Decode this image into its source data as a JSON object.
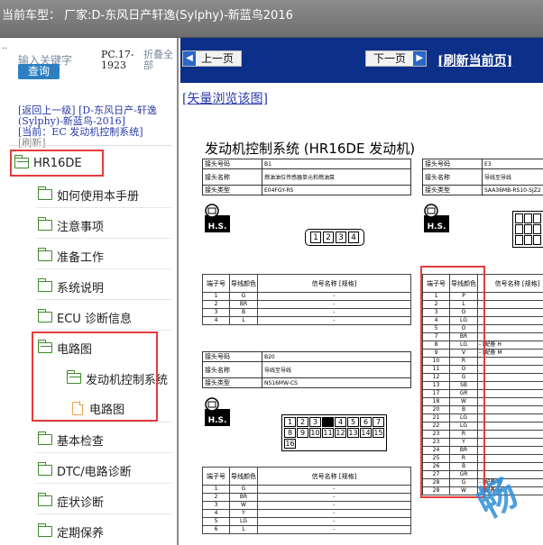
{
  "window": {
    "title": "当前车型：  厂家:D-东风日产轩逸(Sylphy)-新蓝鸟2016"
  },
  "sidebar": {
    "dots": "..",
    "search_placeholder": "输入关键字",
    "search_button": "查询",
    "pc_code": "PC.17-1923",
    "fold_all": "折叠全部",
    "back_link": "[返回上一级] [D-东风日产-轩逸(Sylphy)-新蓝鸟-2016]",
    "current": "[当前：EC 发动机控制系统]",
    "refresh": "[刷新]",
    "tree": [
      {
        "label": "HR16DE",
        "type": "folder-open"
      },
      {
        "label": "如何使用本手册",
        "type": "folder"
      },
      {
        "label": "注意事项",
        "type": "folder"
      },
      {
        "label": "准备工作",
        "type": "folder"
      },
      {
        "label": "系统说明",
        "type": "folder"
      },
      {
        "label": "ECU 诊断信息",
        "type": "folder"
      },
      {
        "label": "电路图",
        "type": "folder-open"
      },
      {
        "label": "发动机控制系统",
        "type": "folder-open"
      },
      {
        "label": "电路图",
        "type": "doc"
      },
      {
        "label": "基本检查",
        "type": "folder"
      },
      {
        "label": "DTC/电路诊断",
        "type": "folder"
      },
      {
        "label": "症状诊断",
        "type": "folder"
      },
      {
        "label": "定期保养",
        "type": "folder"
      }
    ]
  },
  "toolbar": {
    "prev": "上一页",
    "next": "下一页",
    "refresh_page": "[刷新当前页]",
    "vector_browse": "[矢量浏览该图]"
  },
  "document": {
    "title": "发动机控制系统 (HR16DE 发动机)",
    "conn_e1": {
      "no_k": "接头号码",
      "no_v": "B1",
      "name_k": "接头名称",
      "name_v": "燃油油位传感器单元和燃油泵",
      "type_k": "接头类型",
      "type_v": "E04FGY-RS"
    },
    "conn_e2": {
      "no_k": "接头号码",
      "no_v": "E3",
      "name_k": "接头名称",
      "name_v": "导线至导线",
      "type_k": "接头类型",
      "type_v": "SAA36MB-RS10-SJZ2"
    },
    "conn_e3": {
      "no_k": "接头号码",
      "no_v": "B20",
      "name_k": "接头名称",
      "name_v": "导线至导线",
      "type_k": "接头类型",
      "type_v": "NS16MW-CS"
    },
    "hs_label": "H.S.",
    "pin_hdr": {
      "term": "端子号",
      "color": "导线颜色",
      "signal": "信号名称 [规格]"
    },
    "pins_a": [
      [
        "1",
        "G",
        "-"
      ],
      [
        "2",
        "BR",
        "-"
      ],
      [
        "3",
        "B",
        "-"
      ],
      [
        "4",
        "L",
        "-"
      ]
    ],
    "pins_b": [
      [
        "1",
        "P"
      ],
      [
        "2",
        "L"
      ],
      [
        "3",
        "O"
      ],
      [
        "4",
        "LG"
      ],
      [
        "5",
        "O"
      ],
      [
        "7",
        "BR"
      ],
      [
        "8",
        "LG"
      ],
      [
        "9",
        "V"
      ],
      [
        "10",
        "R"
      ],
      [
        "11",
        "O"
      ],
      [
        "12",
        "G"
      ],
      [
        "13",
        "SB"
      ],
      [
        "17",
        "GR"
      ],
      [
        "18",
        "W"
      ],
      [
        "20",
        "B"
      ],
      [
        "21",
        "LG"
      ],
      [
        "22",
        "LG"
      ],
      [
        "23",
        "R"
      ],
      [
        "23",
        "Y"
      ],
      [
        "24",
        "BR"
      ],
      [
        "25",
        "R"
      ],
      [
        "26",
        "B"
      ],
      [
        "27",
        "GR"
      ],
      [
        "28",
        "G"
      ],
      [
        "28",
        "W"
      ]
    ],
    "pins_b_signal": {
      "8": "- [配备 H",
      "9": "- [配备 M",
      "28a": "- [配备 M",
      "28b": "- [配备 M"
    },
    "pins_c": [
      [
        "1",
        "G",
        "-"
      ],
      [
        "2",
        "BR",
        "-"
      ],
      [
        "3",
        "W",
        "-"
      ],
      [
        "4",
        "Y",
        "-"
      ],
      [
        "5",
        "LG",
        "-"
      ],
      [
        "6",
        "L",
        "-"
      ]
    ],
    "connector_a": [
      "1",
      "2",
      "3",
      "4"
    ],
    "connector_c": [
      "1",
      "2",
      "3",
      "",
      "4",
      "5",
      "6",
      "7",
      "8",
      "9",
      "10",
      "11",
      "12",
      "13",
      "14",
      "15",
      "16"
    ]
  }
}
